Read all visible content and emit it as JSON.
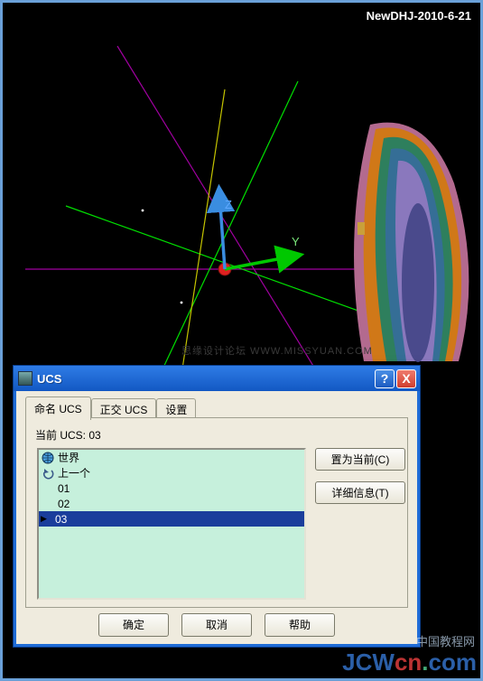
{
  "viewport": {
    "title_label": "NewDHJ-2010-6-21",
    "faint_watermark": "思缘设计论坛  WWW.MISSYUAN.COM",
    "axis_z_label": "Z",
    "axis_y_label": "Y"
  },
  "dialog": {
    "title": "UCS",
    "help_tooltip": "?",
    "close_tooltip": "X",
    "tabs": [
      {
        "label": "命名 UCS"
      },
      {
        "label": "正交 UCS"
      },
      {
        "label": "设置"
      }
    ],
    "current_ucs_prefix": "当前 UCS: ",
    "current_ucs_value": "03",
    "list": [
      {
        "icon": "globe-icon",
        "label": "世界"
      },
      {
        "icon": "back-arrow-icon",
        "label": "上一个"
      },
      {
        "icon": "",
        "label": "01"
      },
      {
        "icon": "",
        "label": "02"
      },
      {
        "icon": "",
        "label": "03",
        "selected": true
      }
    ],
    "side_buttons": {
      "set_current": "置为当前(C)",
      "details": "详细信息(T)"
    },
    "bottom_buttons": {
      "ok": "确定",
      "cancel": "取消",
      "help": "帮助"
    }
  },
  "watermark": {
    "line1": "中国教程网",
    "line2_jcw": "JCW",
    "line2_cn": "cn",
    "line2_dot": ".",
    "line2_com": "com"
  }
}
